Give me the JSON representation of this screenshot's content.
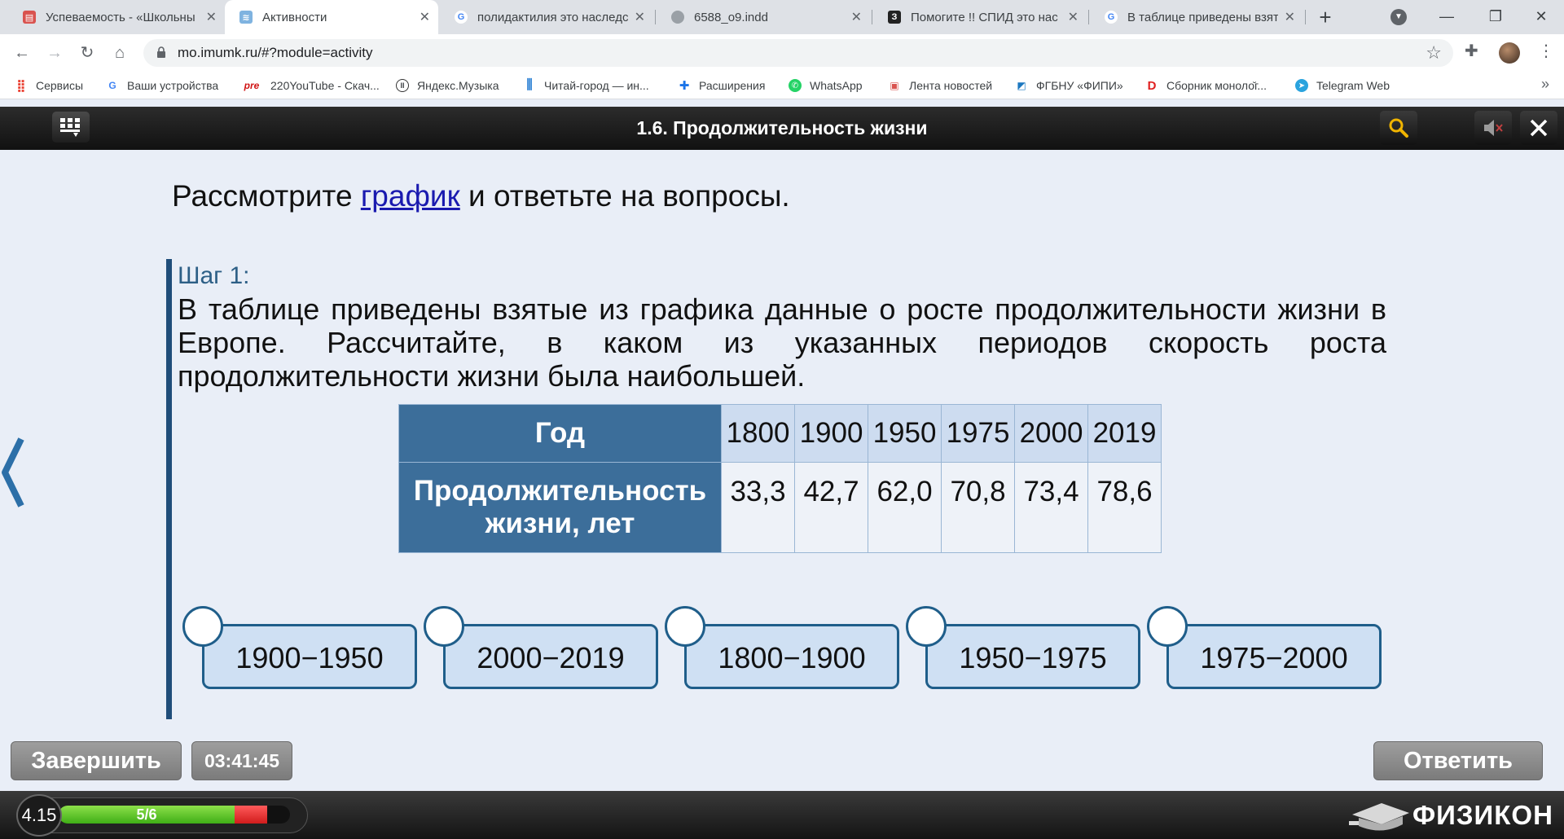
{
  "browser": {
    "tabs": [
      {
        "title": "Успеваемость - «Школьны",
        "icon": "school-favicon"
      },
      {
        "title": "Активности",
        "icon": "imumk-favicon"
      },
      {
        "title": "полидактилия это наследс",
        "icon": "google-favicon"
      },
      {
        "title": "6588_o9.indd",
        "icon": "globe-favicon"
      },
      {
        "title": "Помогите !! СПИД это нас",
        "icon": "znanija-favicon"
      },
      {
        "title": "В таблице приведены взят",
        "icon": "google-favicon"
      }
    ],
    "url": "mo.imumk.ru/#?module=activity",
    "bookmarks": [
      {
        "label": "Сервисы",
        "icon": "apps-icon"
      },
      {
        "label": "Ваши устройства",
        "icon": "google-favicon"
      },
      {
        "label": "220YouTube - Скач...",
        "icon": "pre-favicon",
        "badge": "pre"
      },
      {
        "label": "Яндекс.Музыка",
        "icon": "yandex-music-favicon"
      },
      {
        "label": "Читай-город — ин...",
        "icon": "chitai-gorod-favicon"
      },
      {
        "label": "Расширения",
        "icon": "puzzle-icon"
      },
      {
        "label": "WhatsApp",
        "icon": "whatsapp-favicon"
      },
      {
        "label": "Лента новостей",
        "icon": "news-favicon"
      },
      {
        "label": "ФГБНУ «ФИПИ»",
        "icon": "fipi-favicon"
      },
      {
        "label": "Сборник моноло̆г...",
        "icon": "d-favicon"
      },
      {
        "label": "Telegram Web",
        "icon": "telegram-favicon"
      }
    ]
  },
  "app": {
    "title": "1.6. Продолжительность жизни",
    "intro_before": "Рассмотрите ",
    "intro_link": "график",
    "intro_after": " и ответьте на вопросы.",
    "step_label": "Шаг 1:",
    "task_text": "В таблице приведены взятые из графика данные о росте продолжительности жизни в Европе. Рассчитайте, в каком из указанных периодов скорость роста продолжительности жизни была наибольшей.",
    "table": {
      "header_year": "Год",
      "header_life": "Продолжительность жизни, лет",
      "years": [
        "1800",
        "1900",
        "1950",
        "1975",
        "2000",
        "2019"
      ],
      "values": [
        "33,3",
        "42,7",
        "62,0",
        "70,8",
        "73,4",
        "78,6"
      ]
    },
    "options": [
      "1900−1950",
      "2000−2019",
      "1800−1900",
      "1950−1975",
      "1975−2000"
    ],
    "finish_label": "Завершить",
    "timer": "03:41:45",
    "answer_label": "Ответить",
    "level": "4.15",
    "progress_text": "5/6",
    "progress": {
      "green_fraction": 0.76,
      "red_fraction": 0.14
    },
    "logo_text": "ФИЗИКОН",
    "colors": {
      "accent": "#3c6e9a",
      "card_border": "#1f5e8a",
      "link": "#1a1aaf"
    }
  }
}
